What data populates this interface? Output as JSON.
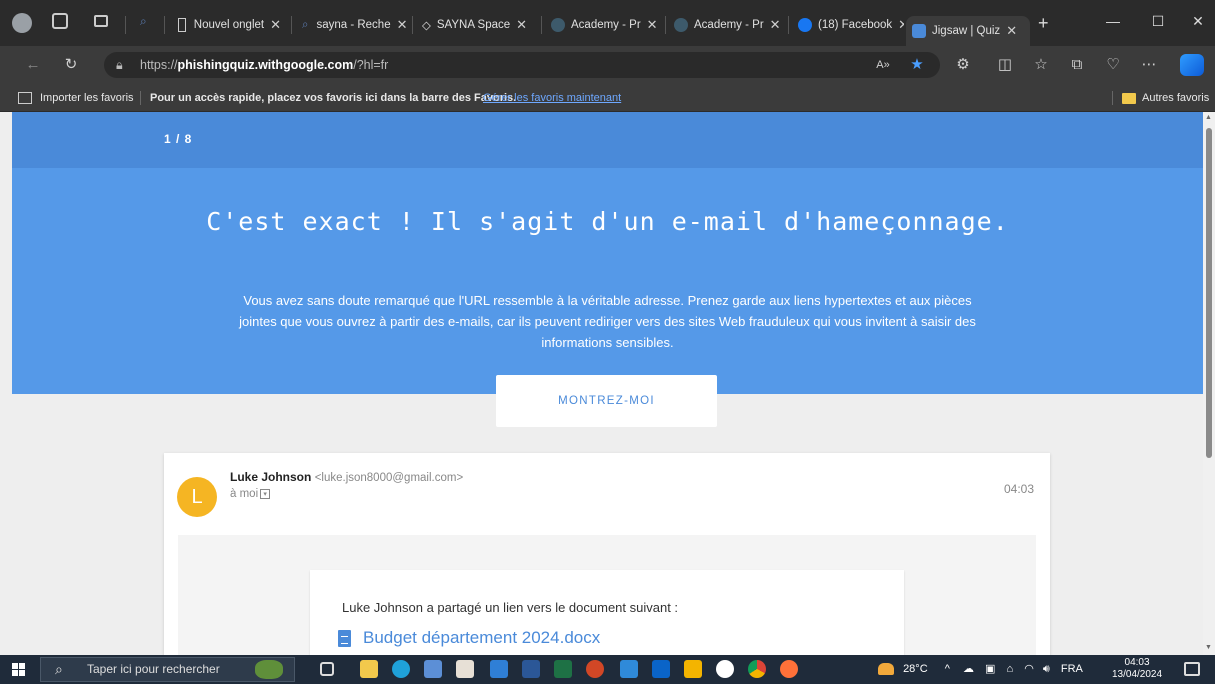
{
  "browser": {
    "tabs": [
      {
        "label": "Nouvel onglet",
        "icon": "page-icon"
      },
      {
        "label": "sayna - Reche",
        "icon": "search-icon"
      },
      {
        "label": "SAYNA Space",
        "icon": "sayna-icon"
      },
      {
        "label": "Academy - Pr",
        "icon": "academy-icon"
      },
      {
        "label": "Academy - Pr",
        "icon": "academy-icon"
      },
      {
        "label": "(18) Facebook",
        "icon": "facebook-icon"
      },
      {
        "label": "Jigsaw | Quiz",
        "icon": "jigsaw-icon"
      }
    ],
    "url_prefix": "https://",
    "url_domain": "phishingquiz.withgoogle.com",
    "url_path": "/?hl=fr",
    "favorites": {
      "import": "Importer les favoris",
      "hint": "Pour un accès rapide, placez vos favoris ici dans la barre des Favoris.",
      "manage": "Gérer les favoris maintenant",
      "other": "Autres favoris"
    }
  },
  "quiz": {
    "progress": "1 / 8",
    "headline": "C'est exact ! Il s'agit d'un e-mail d'hameçonnage.",
    "description": "Vous avez sans doute remarqué que l'URL ressemble à la véritable adresse. Prenez garde aux liens hypertextes et aux pièces jointes que vous ouvrez à partir des e-mails, car ils peuvent rediriger vers des sites Web frauduleux qui vous invitent à saisir des informations sensibles.",
    "button": "MONTREZ-MOI"
  },
  "email": {
    "avatar_letter": "L",
    "sender_name": "Luke Johnson",
    "sender_address": "<luke.json8000@gmail.com>",
    "to": "à moi",
    "time": "04:03",
    "share_text": "Luke Johnson a partagé un lien vers le document suivant :",
    "document": "Budget département 2024.docx"
  },
  "taskbar": {
    "search_placeholder": "Taper ici pour rechercher",
    "temperature": "28°C",
    "language": "FRA",
    "clock_time": "04:03",
    "clock_date": "13/04/2024"
  },
  "colors": {
    "quiz_blue": "#5599e8",
    "progress_blue": "#4a8ad9",
    "avatar": "#f5b523"
  }
}
